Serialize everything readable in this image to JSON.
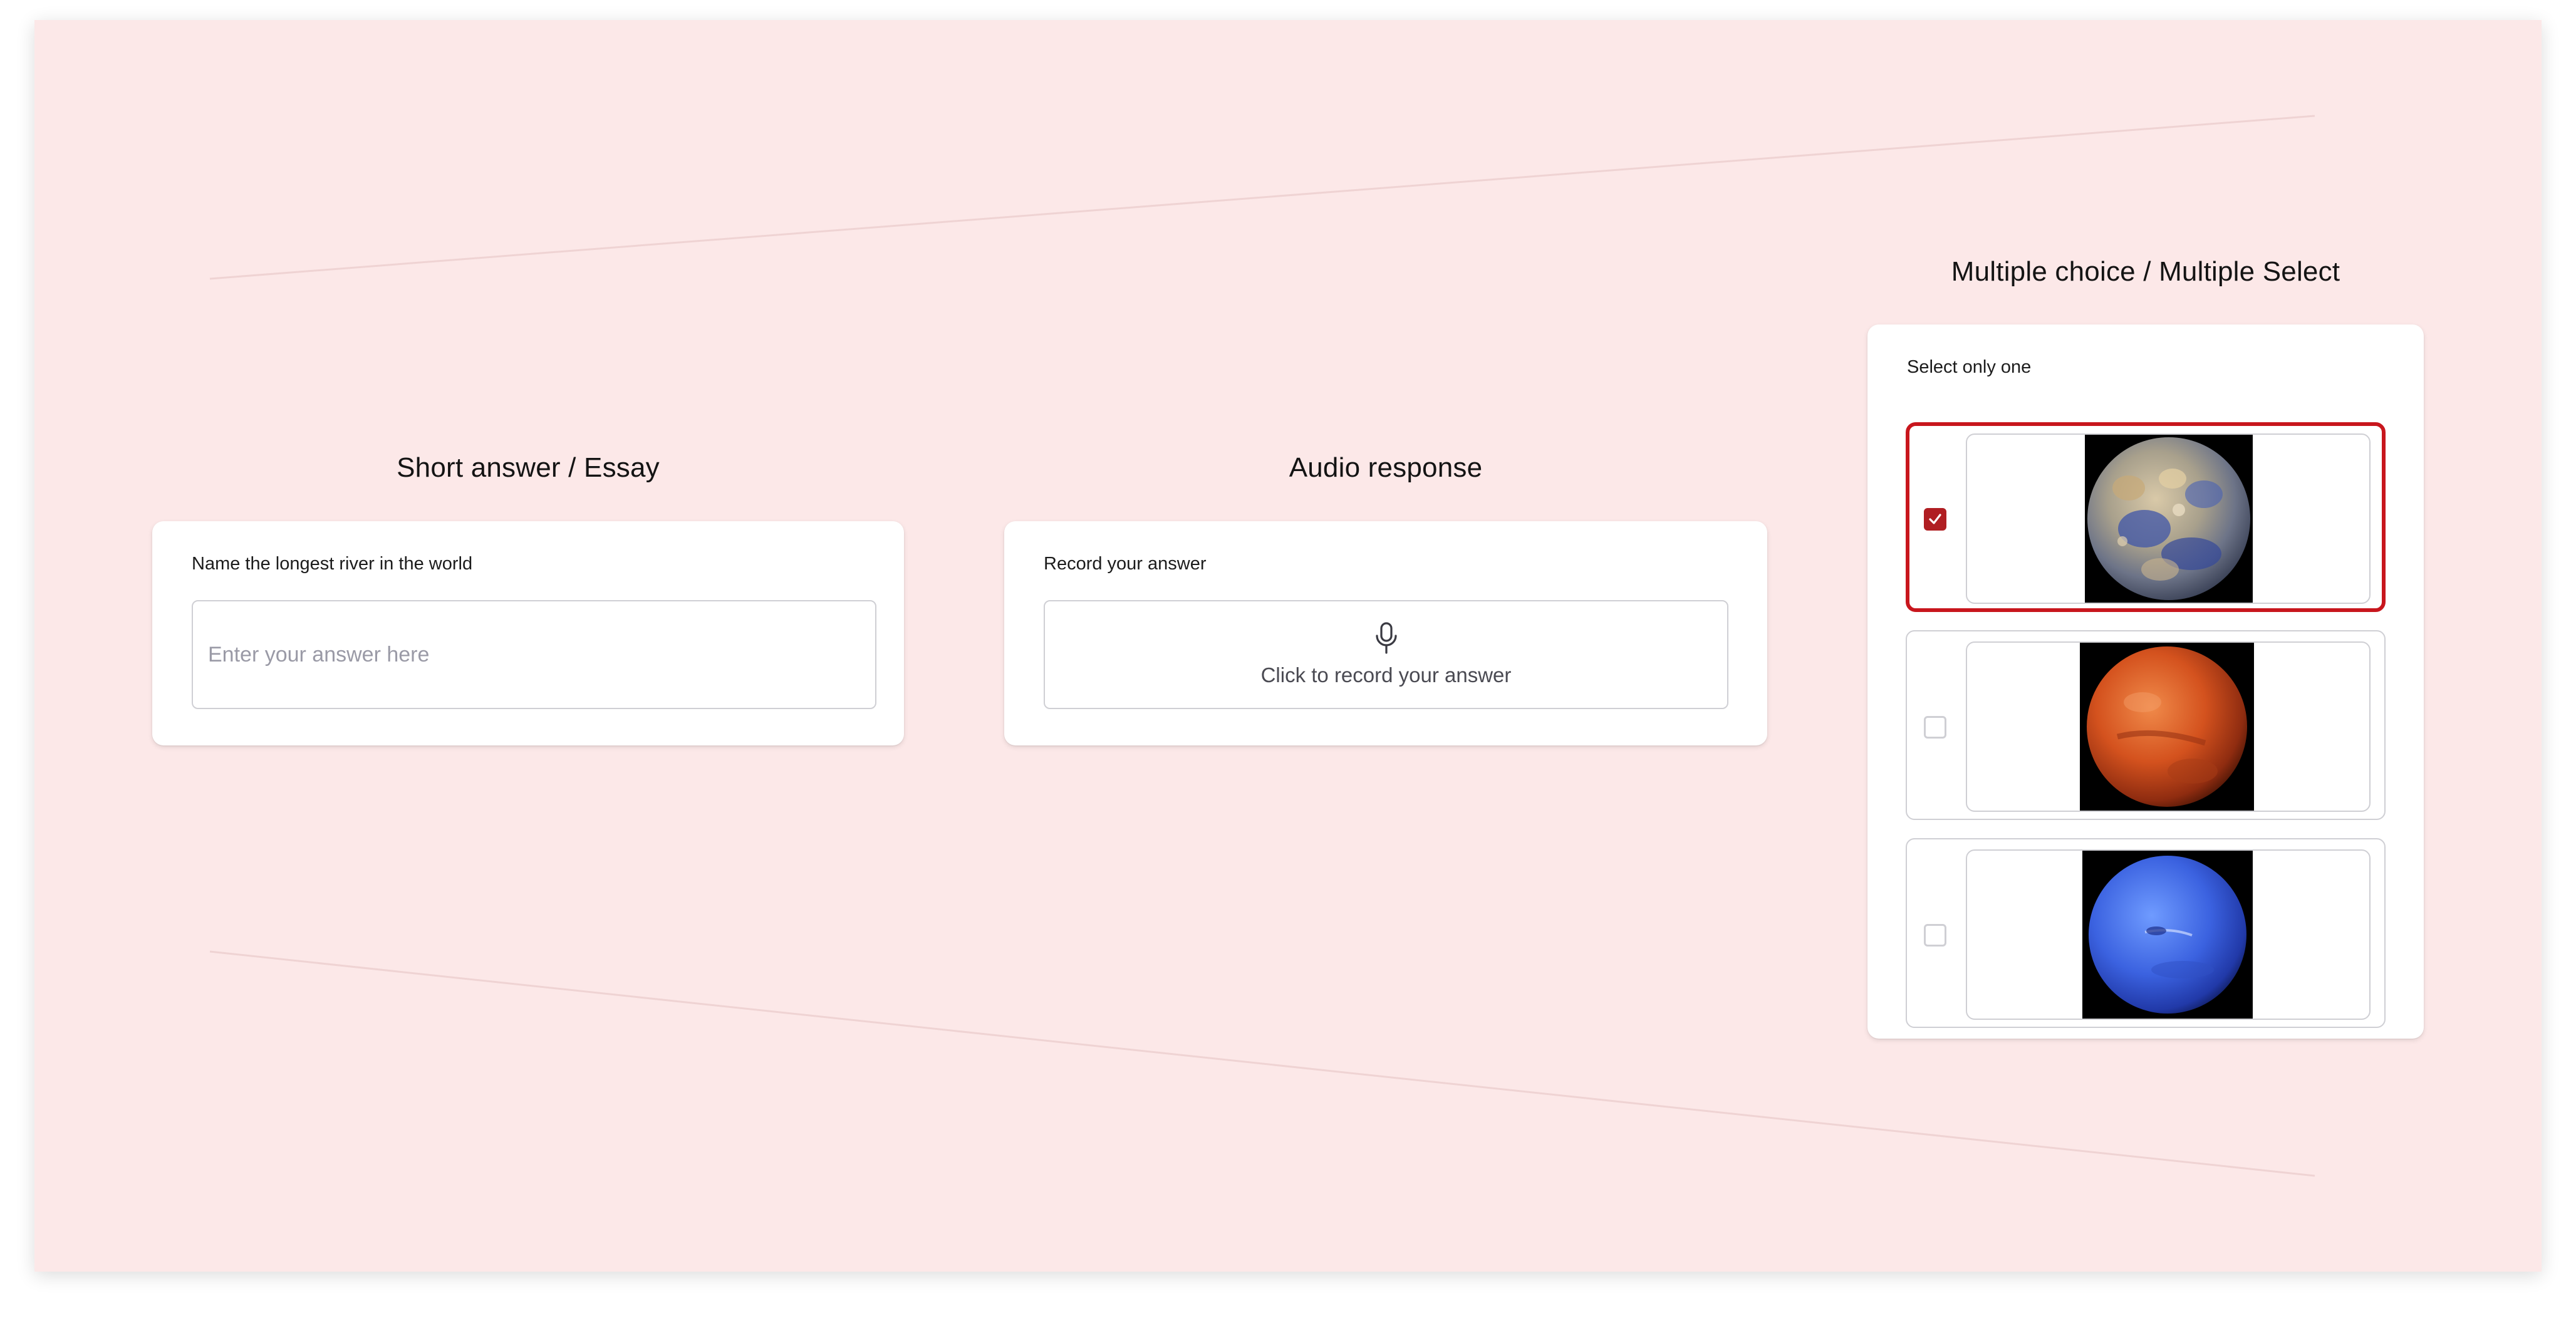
{
  "short_answer": {
    "title": "Short answer / Essay",
    "question": "Name the longest river in the world",
    "value": "",
    "placeholder": "Enter your answer here"
  },
  "audio_response": {
    "title": "Audio response",
    "question": "Record your answer",
    "button_label": "Click to record your answer",
    "icon": "microphone-icon"
  },
  "multiple_choice": {
    "title": "Multiple choice / Multiple Select",
    "instruction": "Select only one",
    "options": [
      {
        "image": "mercury-planet",
        "selected": true
      },
      {
        "image": "mars-planet",
        "selected": false
      },
      {
        "image": "neptune-planet",
        "selected": false
      }
    ]
  },
  "colors": {
    "background": "#fce8e8",
    "accent": "#c8161d",
    "card": "#ffffff",
    "border": "#cfcfd4",
    "placeholder": "#9a9aa6"
  }
}
